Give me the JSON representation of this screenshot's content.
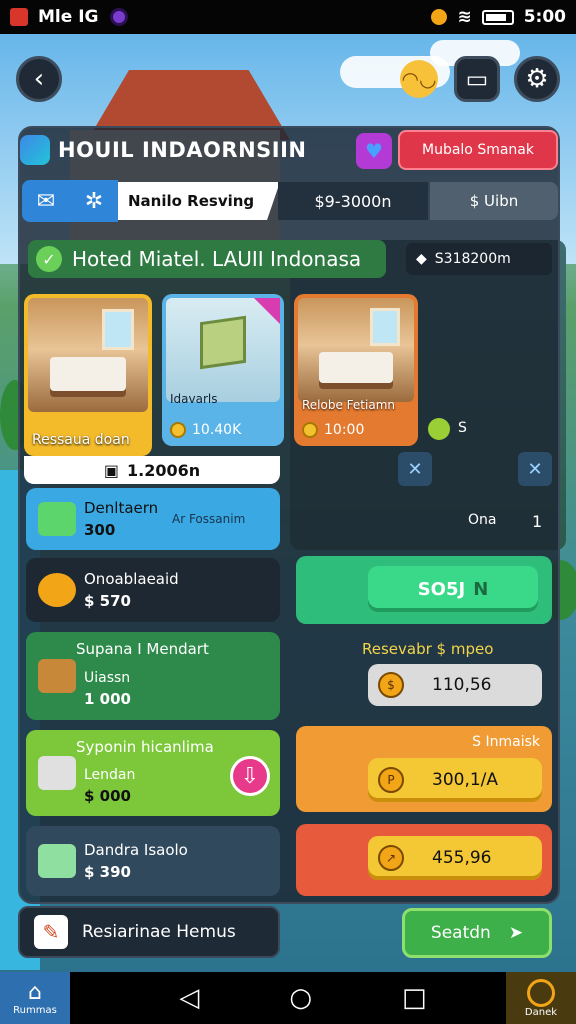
{
  "status": {
    "left": "Mle IG",
    "time": "5:00"
  },
  "header": {
    "title": "HOUIL INDAORNSIIN",
    "promo_button": "Mubalo Smanak"
  },
  "tabs": {
    "active": "Nanilo Resving",
    "price": "$9-3000n",
    "other": "$ Uibn"
  },
  "section": {
    "title": "Hoted Miatel. LAUII Indonasa",
    "price": "S318200m"
  },
  "rooms": [
    {
      "caption": "Ressaua doan"
    },
    {
      "caption": "Idavarls",
      "price": "10.40K"
    },
    {
      "caption": "Relobe Fetiamn",
      "price": "10:00"
    }
  ],
  "room_footer": {
    "value": "1.2006n"
  },
  "dot_text": "S",
  "list": {
    "item1": {
      "title": "Denltaern",
      "value": "300",
      "side": "Ar Fossanim"
    },
    "item2": {
      "title": "Onoablaeaid",
      "value": "$ 570"
    },
    "item3": {
      "head": "Supana I Mendart",
      "sub": "Uiassn",
      "value": "1 000"
    },
    "item4": {
      "head": "Syponin hicanlima",
      "sub": "Lendan",
      "value": "$ 000"
    },
    "item5": {
      "title": "Dandra Isaolo",
      "value": "$ 390"
    }
  },
  "right": {
    "green_value": "SO5J",
    "green_suffix": "N",
    "grey_label": "Resevabr $ mpeo",
    "grey_value": "110,56",
    "orange_label": "S Inmaisk",
    "orange_value": "300,1/A",
    "red_value": "455,96",
    "tool_value": "Ona",
    "tool_count": "1"
  },
  "bottom": {
    "left_label": "Resiarinae Hemus",
    "search_label": "Seatdn",
    "nav_home": "Rummas",
    "nav_right": "Danek"
  }
}
